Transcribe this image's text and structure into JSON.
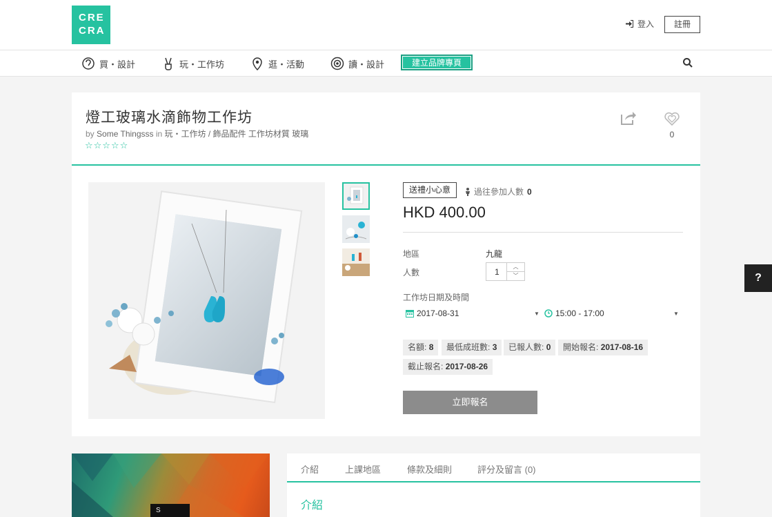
{
  "header": {
    "logo_line1": "CRE",
    "logo_line2": "CRA",
    "login": "登入",
    "register": "註冊"
  },
  "nav": {
    "items": [
      {
        "label": "買・設計",
        "icon": "ear-icon"
      },
      {
        "label": "玩・工作坊",
        "icon": "peace-hand-icon"
      },
      {
        "label": "逛・活動",
        "icon": "location-pin-icon"
      },
      {
        "label": "讀・設計",
        "icon": "eye-icon"
      }
    ],
    "brand_button": "建立品牌專頁"
  },
  "product": {
    "title": "燈工玻璃水滴飾物工作坊",
    "by_prefix": "by",
    "author": "Some Thingsss",
    "in_prefix": "in",
    "category": "玩・工作坊 / 飾品配件",
    "tag1": "工作坊材質",
    "tag2": "玻璃",
    "stars": "☆☆☆☆☆",
    "like_count": "0",
    "gift_tag": "送禮小心意",
    "past_label": "過往參加人數",
    "past_count": "0",
    "price": "HKD 400.00",
    "region_label": "地區",
    "region_value": "九龍",
    "people_label": "人數",
    "people_value": "1",
    "datetime_label": "工作坊日期及時間",
    "date_value": "2017-08-31",
    "time_value": "15:00 - 17:00",
    "quota_label": "名額:",
    "quota_value": "8",
    "min_label": "最低成班數:",
    "min_value": "3",
    "enrolled_label": "已報人數:",
    "enrolled_value": "0",
    "start_label": "開始報名:",
    "start_value": "2017-08-16",
    "end_label": "截止報名:",
    "end_value": "2017-08-26",
    "enroll_button": "立即報名"
  },
  "tabs": [
    "介紹",
    "上課地區",
    "條款及細則",
    "評分及留言 (0)"
  ],
  "intro_heading": "介紹",
  "banner_text": "S",
  "help": "?",
  "colors": {
    "accent": "#26c2a0",
    "button_gray": "#8c8c8c"
  }
}
